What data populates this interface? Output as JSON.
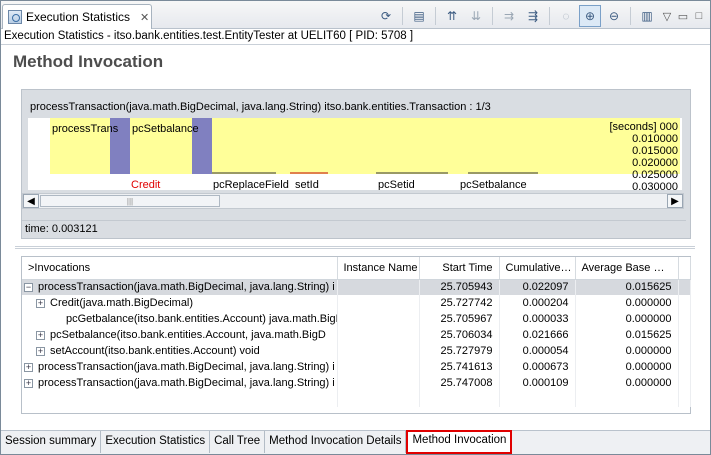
{
  "view": {
    "tab_label": "Execution Statistics",
    "close_glyph": "✕",
    "status_line": "Execution Statistics - itso.bank.entities.test.EntityTester at UELIT60 [ PID: 5708 ]"
  },
  "toolbar": {
    "icons": [
      "refresh-icon",
      "open-source-icon",
      "sort-ascending-icon",
      "sort-descending-icon",
      "show-callers-icon",
      "show-callees-icon",
      "zoom-fit-icon",
      "zoom-in-icon",
      "zoom-out-icon",
      "export-icon",
      "view-menu-icon",
      "minimize-icon",
      "maximize-icon"
    ]
  },
  "page": {
    "title": "Method Invocation"
  },
  "graph": {
    "header": "processTransaction(java.math.BigDecimal, java.lang.String) itso.bank.entities.Transaction : 1/3",
    "bar_labels_top": [
      "processTrans",
      "pcSetbalance"
    ],
    "bar_labels_bottom": [
      "Credit",
      "pcReplaceField",
      "setId",
      "pcSetid",
      "pcSetbalance"
    ],
    "y_axis": [
      "[seconds] 000",
      "0.010000",
      "0.015000",
      "0.020000",
      "0.025000",
      "0.030000"
    ],
    "scroll_thumb_glyph": "|||",
    "time_label": "time: 0.003121",
    "colors": {
      "bar_fill": "#ffff99",
      "bar_edge": "#8080c0",
      "credit_text": "#e00000"
    }
  },
  "table": {
    "columns": [
      ">Invocations",
      "Instance Name",
      "Start Time",
      "Cumulative…",
      "Average Base …"
    ],
    "rows": [
      {
        "toggle": "−",
        "indent": 0,
        "name": "processTransaction(java.math.BigDecimal, java.lang.String) i",
        "instance": "",
        "start": "25.705943",
        "cumulative": "0.022097",
        "average": "0.015625",
        "selected": true
      },
      {
        "toggle": "+",
        "indent": 1,
        "name": "Credit(java.math.BigDecimal)",
        "instance": "",
        "start": "25.727742",
        "cumulative": "0.000204",
        "average": "0.000000",
        "selected": false
      },
      {
        "toggle": "",
        "indent": 2,
        "name": "pcGetbalance(itso.bank.entities.Account) java.math.BigD",
        "instance": "",
        "start": "25.705967",
        "cumulative": "0.000033",
        "average": "0.000000",
        "selected": false
      },
      {
        "toggle": "+",
        "indent": 1,
        "name": "pcSetbalance(itso.bank.entities.Account, java.math.BigD",
        "instance": "",
        "start": "25.706034",
        "cumulative": "0.021666",
        "average": "0.015625",
        "selected": false
      },
      {
        "toggle": "+",
        "indent": 1,
        "name": "setAccount(itso.bank.entities.Account) void",
        "instance": "",
        "start": "25.727979",
        "cumulative": "0.000054",
        "average": "0.000000",
        "selected": false
      },
      {
        "toggle": "+",
        "indent": 0,
        "name": "processTransaction(java.math.BigDecimal, java.lang.String) i",
        "instance": "",
        "start": "25.741613",
        "cumulative": "0.000673",
        "average": "0.000000",
        "selected": false
      },
      {
        "toggle": "+",
        "indent": 0,
        "name": "processTransaction(java.math.BigDecimal, java.lang.String) i",
        "instance": "",
        "start": "25.747008",
        "cumulative": "0.000109",
        "average": "0.000000",
        "selected": false
      }
    ]
  },
  "bottom_tabs": [
    "Session summary",
    "Execution Statistics",
    "Call Tree",
    "Method Invocation Details",
    "Method Invocation"
  ],
  "active_bottom_tab": "Method Invocation"
}
